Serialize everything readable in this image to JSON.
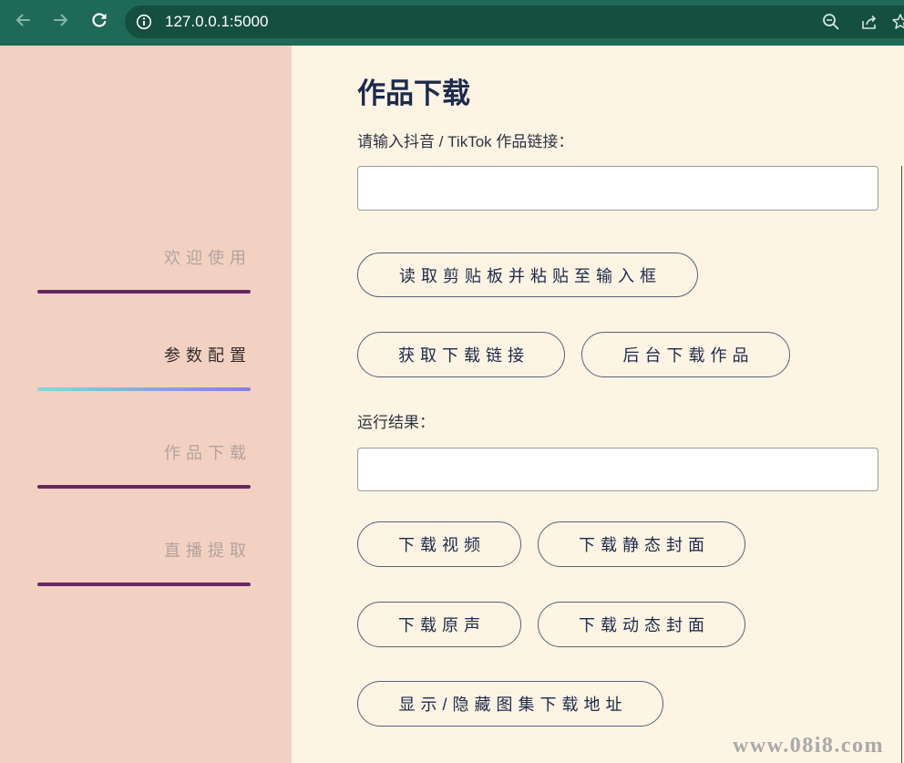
{
  "browser": {
    "url": "127.0.0.1:5000",
    "icons": {
      "back": "arrow-left-icon",
      "forward": "arrow-right-icon",
      "reload": "reload-icon",
      "site_info": "info-icon",
      "zoom": "zoom-out-icon",
      "share": "share-icon",
      "bookmark": "star-icon"
    }
  },
  "sidebar": {
    "items": [
      {
        "label": "欢迎使用",
        "active": false
      },
      {
        "label": "参数配置",
        "active": true
      },
      {
        "label": "作品下载",
        "active": false
      },
      {
        "label": "直播提取",
        "active": false
      }
    ]
  },
  "main": {
    "title": "作品下载",
    "link_label": "请输入抖音 / TikTok 作品链接：",
    "link_input": {
      "value": ""
    },
    "paste_button": "读取剪贴板并粘贴至输入框",
    "get_link_button": "获取下载链接",
    "background_download_button": "后台下载作品",
    "result_label": "运行结果：",
    "result_input": {
      "value": ""
    },
    "download_video_button": "下载视频",
    "download_static_cover_button": "下载静态封面",
    "download_audio_button": "下载原声",
    "download_dynamic_cover_button": "下载动态封面",
    "toggle_gallery_button": "显示/隐藏图集下载地址"
  },
  "watermark": {
    "text": "www.08i8.com"
  },
  "colors": {
    "chrome-bg": "#1e6a56",
    "omnibox-bg": "#154f40",
    "sidebar-bg": "#f2d1c3",
    "main-bg": "#fdf4e3",
    "title-color": "#1c2a4d",
    "nav-inactive": "#b4a29c",
    "nav-active": "#332c2c",
    "nav-bar": "#6b2662",
    "nav-bar-active-start": "#7fdcd7",
    "nav-bar-active-end": "#8b7ce6",
    "button-border": "#57627e",
    "input-border": "#9b9b9b"
  }
}
